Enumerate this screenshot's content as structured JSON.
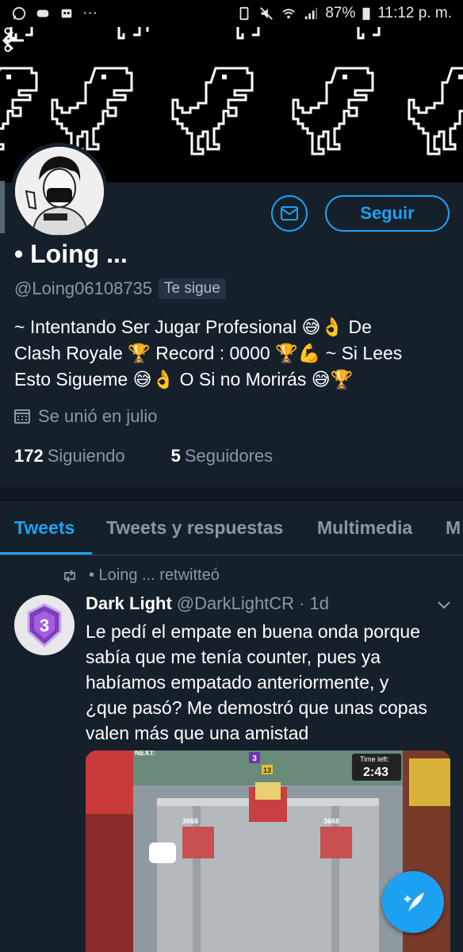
{
  "status_bar": {
    "battery": "87%",
    "time": "11:12 p. m.",
    "dots": "···"
  },
  "profile": {
    "display_name": "• Loing ...",
    "handle": "@Loing06108735",
    "follows_you": "Te sigue",
    "bio_lines": [
      "~ Intentando Ser Jugar Profesional 😅👌 De",
      "Clash Royale 🏆 Record : 0000 🏆💪 ~ Si Lees",
      "Esto Sigueme 😅👌 O Si no Morirás 😅🏆"
    ],
    "joined": "Se unió en julio",
    "following_count": "172",
    "following_label": "Siguiendo",
    "followers_count": "5",
    "followers_label": "Seguidores",
    "follow_button": "Seguir"
  },
  "tabs": [
    {
      "label": "Tweets",
      "active": true
    },
    {
      "label": "Tweets y respuestas",
      "active": false
    },
    {
      "label": "Multimedia",
      "active": false
    },
    {
      "label": "M",
      "active": false
    }
  ],
  "tweet": {
    "retweet_label": "• Loing ... retwitteó",
    "author_name": "Dark Light",
    "author_handle": "@DarkLightCR",
    "age": "· 1d",
    "text_lines": [
      "Le pedí el empate en buena onda porque",
      "sabía que me tenía counter, pues ya",
      "habíamos empatado anteriormente, y",
      "¿que pasó? Me demostró que unas copas",
      "valen más que una amistad"
    ],
    "media": {
      "next_label": "NEXT:",
      "time_left_label": "Time left:",
      "time_left": "2:43",
      "tower_hp_left": "3668",
      "tower_hp_right": "3668",
      "badge": "3",
      "king_level": "13"
    },
    "avatar_badge": "3"
  },
  "colors": {
    "background": "#15202b",
    "accent": "#1da1f2",
    "muted": "#8899a6"
  },
  "icons": {
    "back": "arrow-left-icon",
    "more": "more-vertical-icon",
    "message": "envelope-icon",
    "calendar": "calendar-icon",
    "retweet": "retweet-icon",
    "caret": "chevron-down-icon",
    "compose": "compose-tweet-icon"
  }
}
